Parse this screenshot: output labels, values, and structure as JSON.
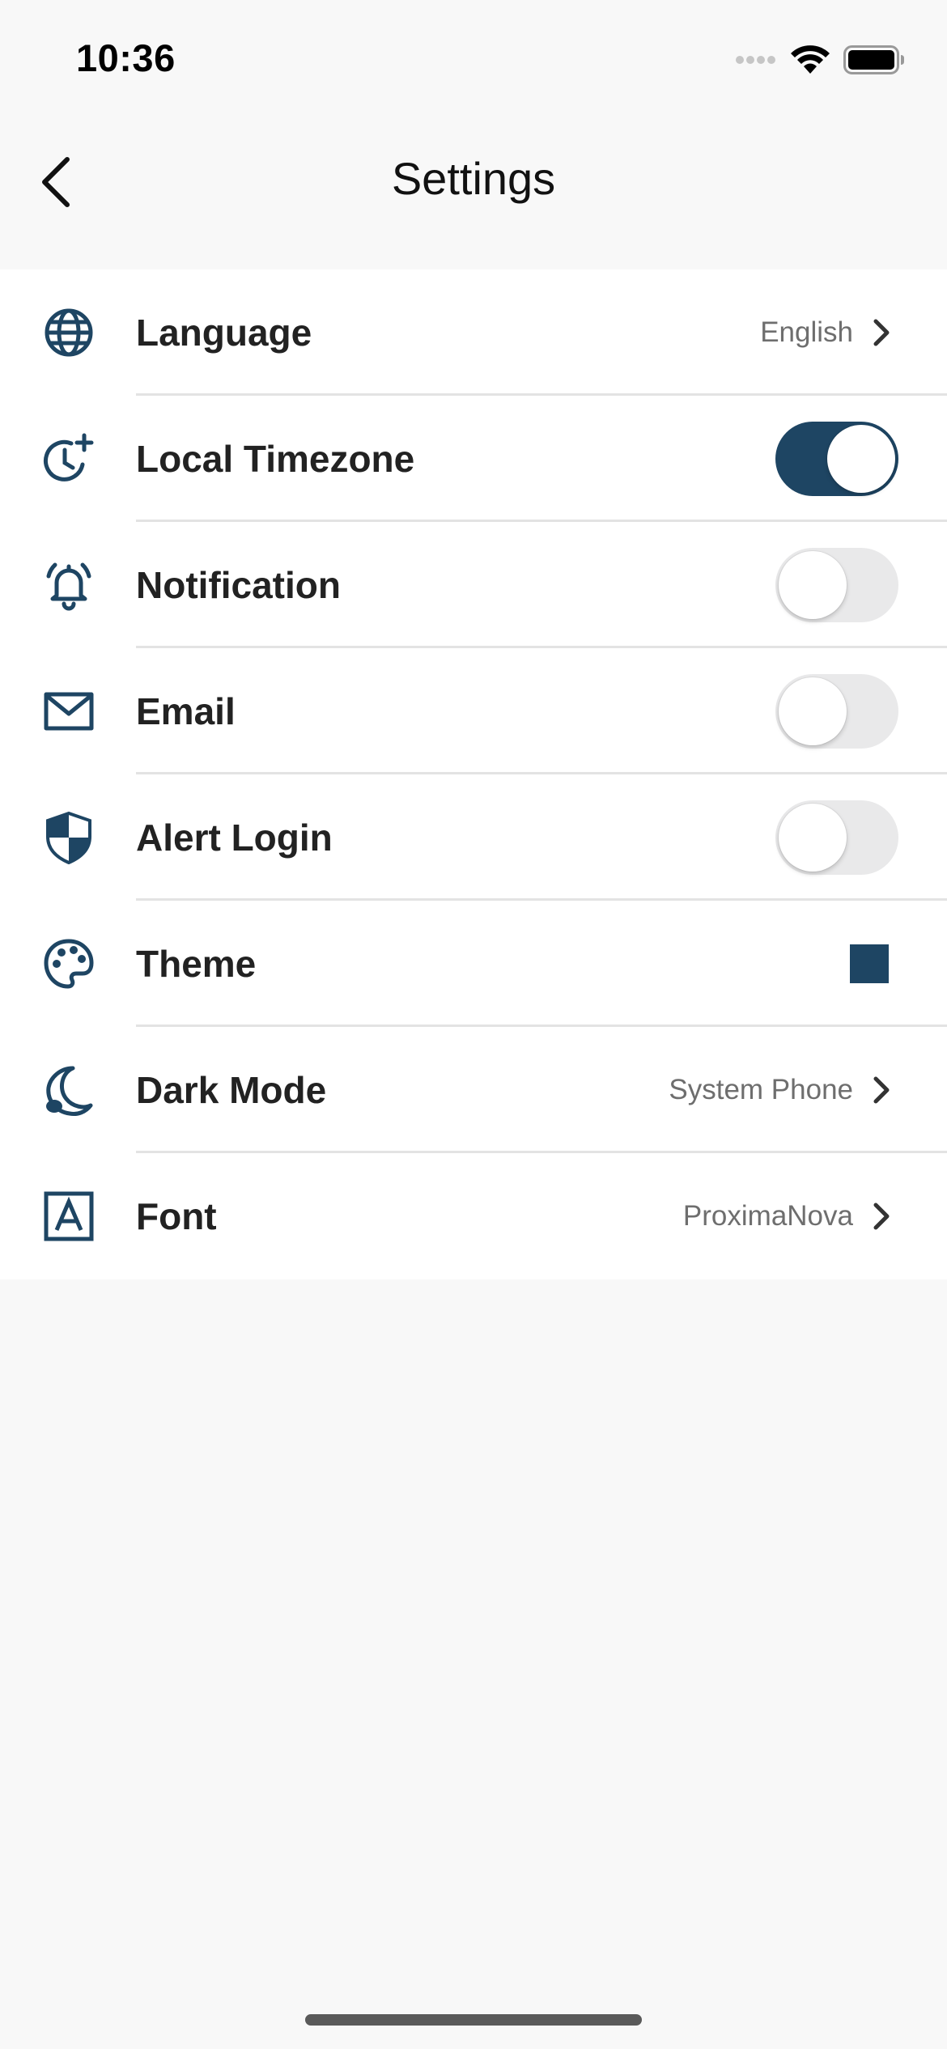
{
  "status_bar": {
    "time": "10:36"
  },
  "nav": {
    "title": "Settings"
  },
  "colors": {
    "accent": "#1e4563",
    "toggle_off": "#e9e9ea",
    "background": "#f8f8f8"
  },
  "settings": {
    "items": [
      {
        "label": "Language",
        "icon": "globe-icon",
        "type": "link",
        "value": "English"
      },
      {
        "label": "Local Timezone",
        "icon": "clock-plus-icon",
        "type": "toggle",
        "on": true
      },
      {
        "label": "Notification",
        "icon": "bell-ringing-icon",
        "type": "toggle",
        "on": false
      },
      {
        "label": "Email",
        "icon": "envelope-icon",
        "type": "toggle",
        "on": false
      },
      {
        "label": "Alert Login",
        "icon": "shield-icon",
        "type": "toggle",
        "on": false
      },
      {
        "label": "Theme",
        "icon": "palette-icon",
        "type": "color",
        "swatch": "#1e4563"
      },
      {
        "label": "Dark Mode",
        "icon": "moon-icon",
        "type": "link",
        "value": "System Phone"
      },
      {
        "label": "Font",
        "icon": "font-icon",
        "type": "link",
        "value": "ProximaNova"
      }
    ]
  }
}
